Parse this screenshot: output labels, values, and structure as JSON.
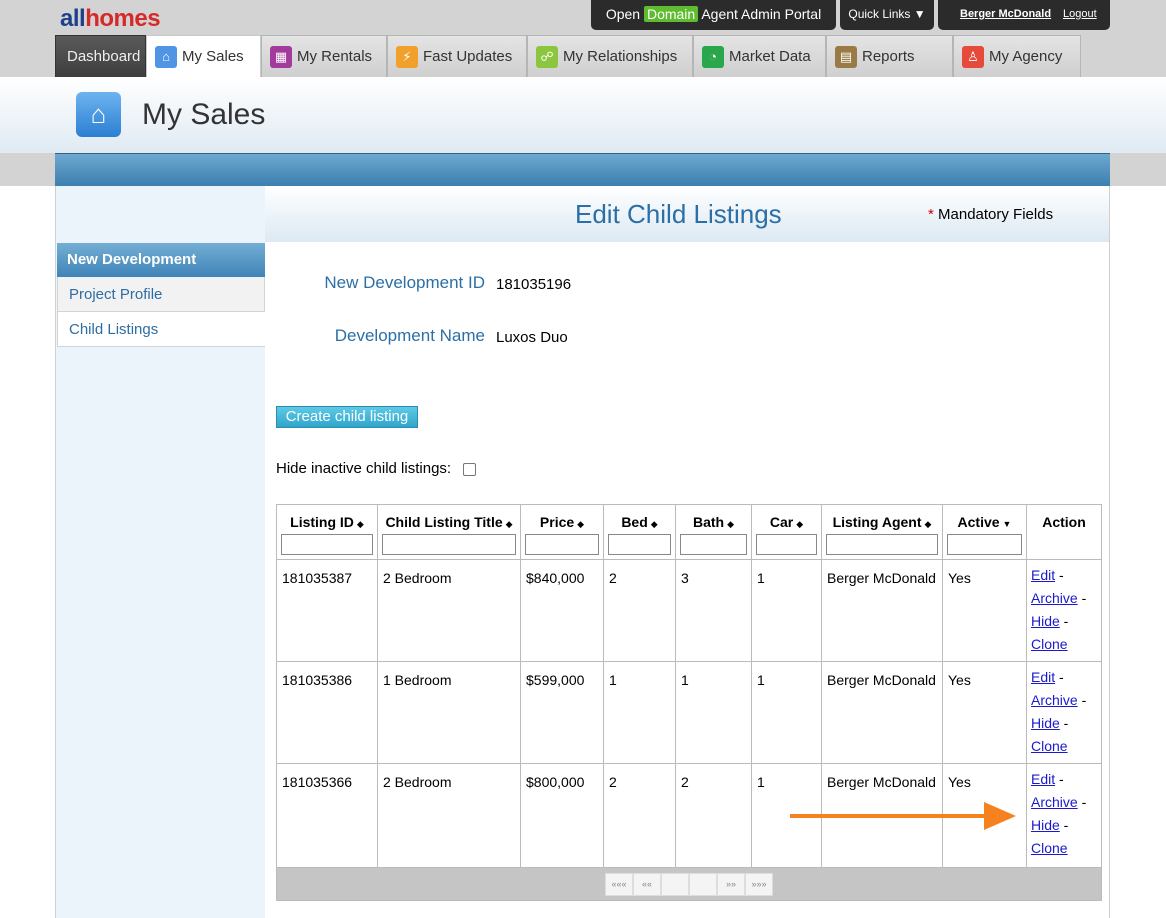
{
  "logo": {
    "part1": "all",
    "part2": "homes"
  },
  "top_links": {
    "portal_open": "Open",
    "portal_domain": "Domain",
    "portal_rest": "Agent Admin Portal",
    "quick_links": "Quick Links ▼",
    "user_name": "Berger McDonald",
    "logout": "Logout"
  },
  "tabs": [
    {
      "label": "Dashboard"
    },
    {
      "label": "My Sales"
    },
    {
      "label": "My Rentals"
    },
    {
      "label": "Fast Updates"
    },
    {
      "label": "My Relationships"
    },
    {
      "label": "Market Data"
    },
    {
      "label": "Reports"
    },
    {
      "label": "My Agency"
    }
  ],
  "page": {
    "title": "My Sales"
  },
  "sidebar": {
    "heading": "New Development",
    "items": [
      {
        "label": "Project Profile"
      },
      {
        "label": "Child Listings"
      }
    ]
  },
  "main": {
    "title": "Edit Child Listings",
    "mandatory_star": "*",
    "mandatory_label": "Mandatory Fields",
    "dev_id_label": "New Development ID",
    "dev_id_value": "181035196",
    "dev_name_label": "Development Name",
    "dev_name_value": "Luxos Duo",
    "create_button": "Create child listing",
    "hide_inactive_label": "Hide inactive child listings:"
  },
  "table": {
    "headers": [
      {
        "label": "Listing ID",
        "sort": "◆"
      },
      {
        "label": "Child Listing Title",
        "sort": "◆"
      },
      {
        "label": "Price",
        "sort": "◆"
      },
      {
        "label": "Bed",
        "sort": "◆"
      },
      {
        "label": "Bath",
        "sort": "◆"
      },
      {
        "label": "Car",
        "sort": "◆"
      },
      {
        "label": "Listing Agent",
        "sort": "◆"
      },
      {
        "label": "Active",
        "sort": "▼"
      },
      {
        "label": "Action",
        "sort": ""
      }
    ],
    "rows": [
      {
        "id": "181035387",
        "title": "2 Bedroom",
        "price": "$840,000",
        "bed": "2",
        "bath": "3",
        "car": "1",
        "agent": "Berger McDonald",
        "active": "Yes"
      },
      {
        "id": "181035386",
        "title": "1 Bedroom",
        "price": "$599,000",
        "bed": "1",
        "bath": "1",
        "car": "1",
        "agent": "Berger McDonald",
        "active": "Yes"
      },
      {
        "id": "181035366",
        "title": "2 Bedroom",
        "price": "$800,000",
        "bed": "2",
        "bath": "2",
        "car": "1",
        "agent": "Berger McDonald",
        "active": "Yes"
      }
    ],
    "actions": {
      "edit": "Edit",
      "archive": "Archive",
      "hide": "Hide",
      "clone": "Clone",
      "sep": " -"
    },
    "pager": {
      "first": "«««",
      "prev": "««",
      "next": "»»",
      "last": "»»»"
    }
  },
  "icons": {
    "house": "house-icon",
    "rentals": "building-icon",
    "fast_updates": "lightning-icon",
    "relationships": "people-icon",
    "market_data": "pie-chart-icon",
    "reports": "report-icon",
    "agency": "person-icon"
  },
  "colors": {
    "accent_blue": "#2b6fa6",
    "annotation_arrow": "#f5821f",
    "domain_green": "#5fbb2f"
  }
}
